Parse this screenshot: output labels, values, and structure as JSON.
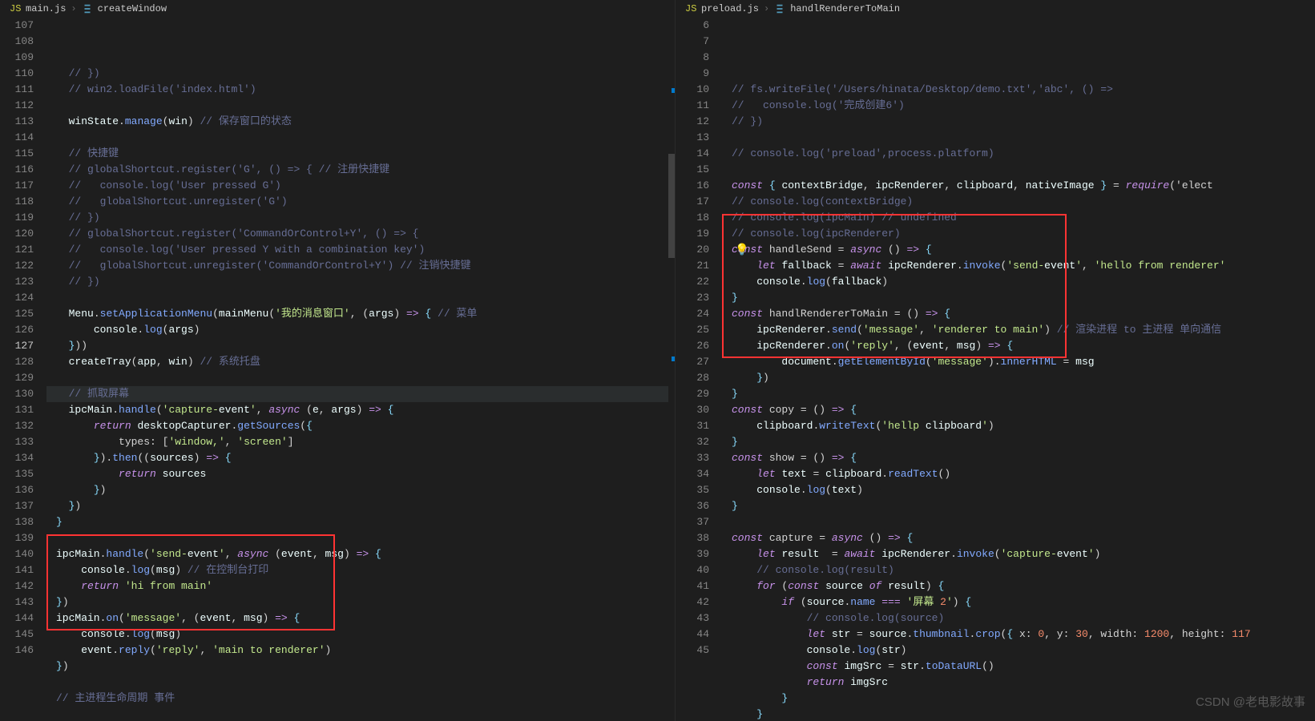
{
  "left": {
    "breadcrumb": {
      "file": "main.js",
      "symbol": "createWindow"
    },
    "lines": [
      107,
      108,
      109,
      110,
      111,
      112,
      113,
      114,
      115,
      116,
      117,
      118,
      119,
      120,
      121,
      122,
      123,
      124,
      125,
      126,
      127,
      128,
      129,
      130,
      131,
      132,
      133,
      134,
      135,
      136,
      137,
      138,
      139,
      140,
      141,
      142,
      143,
      144,
      145,
      146
    ],
    "activeLine": 127,
    "code": {
      "107": "// })",
      "108": "// win2.loadFile('index.html')",
      "110": "winState.manage(win) // 保存窗口的状态",
      "112": "// 快捷键",
      "113": "// globalShortcut.register('G', () => { // 注册快捷键",
      "114": "//   console.log('User pressed G')",
      "115": "//   globalShortcut.unregister('G')",
      "116": "// })",
      "117": "// globalShortcut.register('CommandOrControl+Y', () => {",
      "118": "//   console.log('User pressed Y with a combination key')",
      "119": "//   globalShortcut.unregister('CommandOrControl+Y') // 注销快捷键",
      "120": "// })",
      "122": "Menu.setApplicationMenu(mainMenu('我的消息窗口', (args) => { // 菜单",
      "123": "  console.log(args)",
      "124": "}))",
      "125": "createTray(app, win) // 系统托盘",
      "127": "// 抓取屏幕",
      "128": "ipcMain.handle('capture-event', async (e, args) => {",
      "129": "  return desktopCapturer.getSources({",
      "130": "    types: ['window,', 'screen']",
      "131": "  }).then((sources) => {",
      "132": "    return sources",
      "133": "  })",
      "134": "})",
      "135": "}",
      "137": "ipcMain.handle('send-event', async (event, msg) => {",
      "138": "  console.log(msg) // 在控制台打印",
      "139": "  return 'hi from main'",
      "140": "})",
      "141": "ipcMain.on('message', (event, msg) => {",
      "142": "  console.log(msg)",
      "143": "  event.reply('reply', 'main to renderer')",
      "144": "})",
      "146": "// 主进程生命周期 事件"
    }
  },
  "right": {
    "breadcrumb": {
      "file": "preload.js",
      "symbol": "handlRendererToMain"
    },
    "lines": [
      6,
      7,
      8,
      9,
      10,
      11,
      12,
      13,
      14,
      15,
      16,
      17,
      18,
      19,
      20,
      21,
      22,
      23,
      24,
      25,
      26,
      27,
      28,
      29,
      30,
      31,
      32,
      33,
      34,
      35,
      36,
      37,
      38,
      39,
      40,
      41,
      42,
      43,
      44,
      45
    ],
    "code": {
      "6": "// fs.writeFile('/Users/hinata/Desktop/demo.txt','abc', () =>",
      "7": "//   console.log('完成创建6')",
      "8": "// })",
      "10": "// console.log('preload',process.platform)",
      "12": "const { contextBridge, ipcRenderer, clipboard, nativeImage } = require('elect",
      "13": "// console.log(contextBridge)",
      "14": "// console.log(ipcMain) // undefined",
      "15": "// console.log(ipcRenderer)",
      "16": "const handleSend = async () => {",
      "17": "  let fallback = await ipcRenderer.invoke('send-event', 'hello from renderer'",
      "18": "  console.log(fallback)",
      "19": "}",
      "20": "const handlRendererToMain = () => {",
      "21": "  ipcRenderer.send('message', 'renderer to main') // 渲染进程 to 主进程 单向通信",
      "22": "  ipcRenderer.on('reply', (event, msg) => {",
      "23": "    document.getElementById('message').innerHTML = msg",
      "24": "  })",
      "25": "}",
      "26": "const copy = () => {",
      "27": "  clipboard.writeText('hellp clipboard')",
      "28": "}",
      "29": "const show = () => {",
      "30": "  let text = clipboard.readText()",
      "31": "  console.log(text)",
      "32": "}",
      "34": "const capture = async () => {",
      "35": "  let result  = await ipcRenderer.invoke('capture-event')",
      "36": "  // console.log(result)",
      "37": "  for (const source of result) {",
      "38": "    if (source.name === '屏幕 2') {",
      "39": "      // console.log(source)",
      "40": "      let str = source.thumbnail.crop({ x: 0, y: 30, width: 1200, height: 117",
      "41": "      console.log(str)",
      "42": "      const imgSrc = str.toDataURL()",
      "43": "      return imgSrc",
      "44": "    }",
      "45": "  }"
    }
  },
  "watermark": "CSDN @老电影故事"
}
